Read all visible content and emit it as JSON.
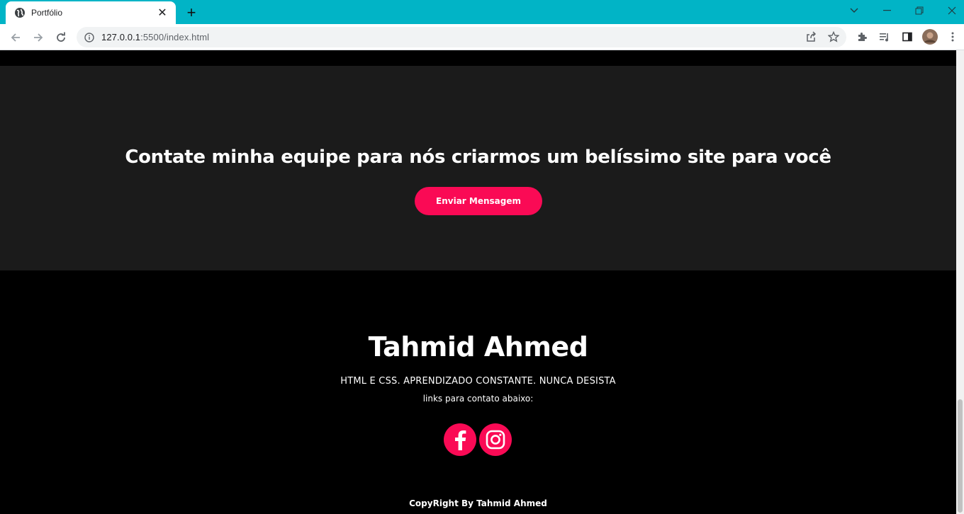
{
  "browser": {
    "tab_title": "Portfólio",
    "url_host": "127.0.0.1",
    "url_rest": ":5500/index.html",
    "accent_color": "#01b4c6"
  },
  "contact": {
    "heading": "Contate minha equipe para nós criarmos um belíssimo site para você",
    "button_label": "Enviar Mensagem",
    "accent_color": "#fa0a55"
  },
  "footer": {
    "name": "Tahmid Ahmed",
    "tagline": "HTML E CSS. APRENDIZADO CONSTANTE. NUNCA DESISTA",
    "links_text": "links para contato abaixo:",
    "social": [
      "facebook-icon",
      "instagram-icon"
    ],
    "copyright": "CopyRight By Tahmid Ahmed"
  }
}
